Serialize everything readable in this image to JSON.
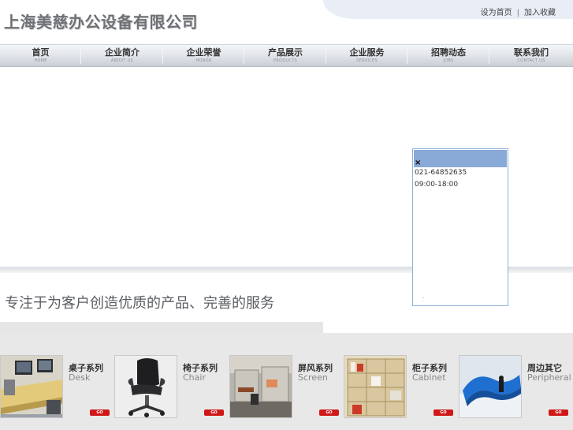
{
  "header": {
    "logo_text": "上海美慈办公设备有限公司",
    "links": [
      "设为首页",
      "加入收藏"
    ],
    "link_separator": "|"
  },
  "nav": {
    "items": [
      {
        "label": "首页",
        "sub": "HOME"
      },
      {
        "label": "企业简介",
        "sub": "ABOUT US"
      },
      {
        "label": "企业荣誉",
        "sub": "HONOR"
      },
      {
        "label": "产品展示",
        "sub": "PRODUCTS"
      },
      {
        "label": "企业服务",
        "sub": "SERVICES"
      },
      {
        "label": "招聘动态",
        "sub": "JOBS"
      },
      {
        "label": "联系我们",
        "sub": "CONTACT US"
      }
    ]
  },
  "popup": {
    "close": "×",
    "phone": "021-64852635",
    "hours": "09:00-18:00",
    "footer_dot": "."
  },
  "slogan": "专注于为客户创造优质的产品、完善的服务",
  "products": [
    {
      "title": "桌子系列",
      "sub": "Desk",
      "go": "GO",
      "image": "desk-photo"
    },
    {
      "title": "椅子系列",
      "sub": "Chair",
      "go": "GO",
      "image": "chair-photo"
    },
    {
      "title": "屏风系列",
      "sub": "Screen",
      "go": "GO",
      "image": "screen-photo"
    },
    {
      "title": "柜子系列",
      "sub": "Cabinet",
      "go": "GO",
      "image": "cabinet-photo"
    },
    {
      "title": "周边其它",
      "sub": "Peripheral",
      "go": "GO",
      "image": "peripheral-photo"
    }
  ],
  "colors": {
    "nav_gradient_top": "#f4f6f8",
    "nav_gradient_bottom": "#c9ced5",
    "popup_bar": "#89a9d6",
    "go_button": "#d01818",
    "product_band": "#e8e8e8"
  }
}
